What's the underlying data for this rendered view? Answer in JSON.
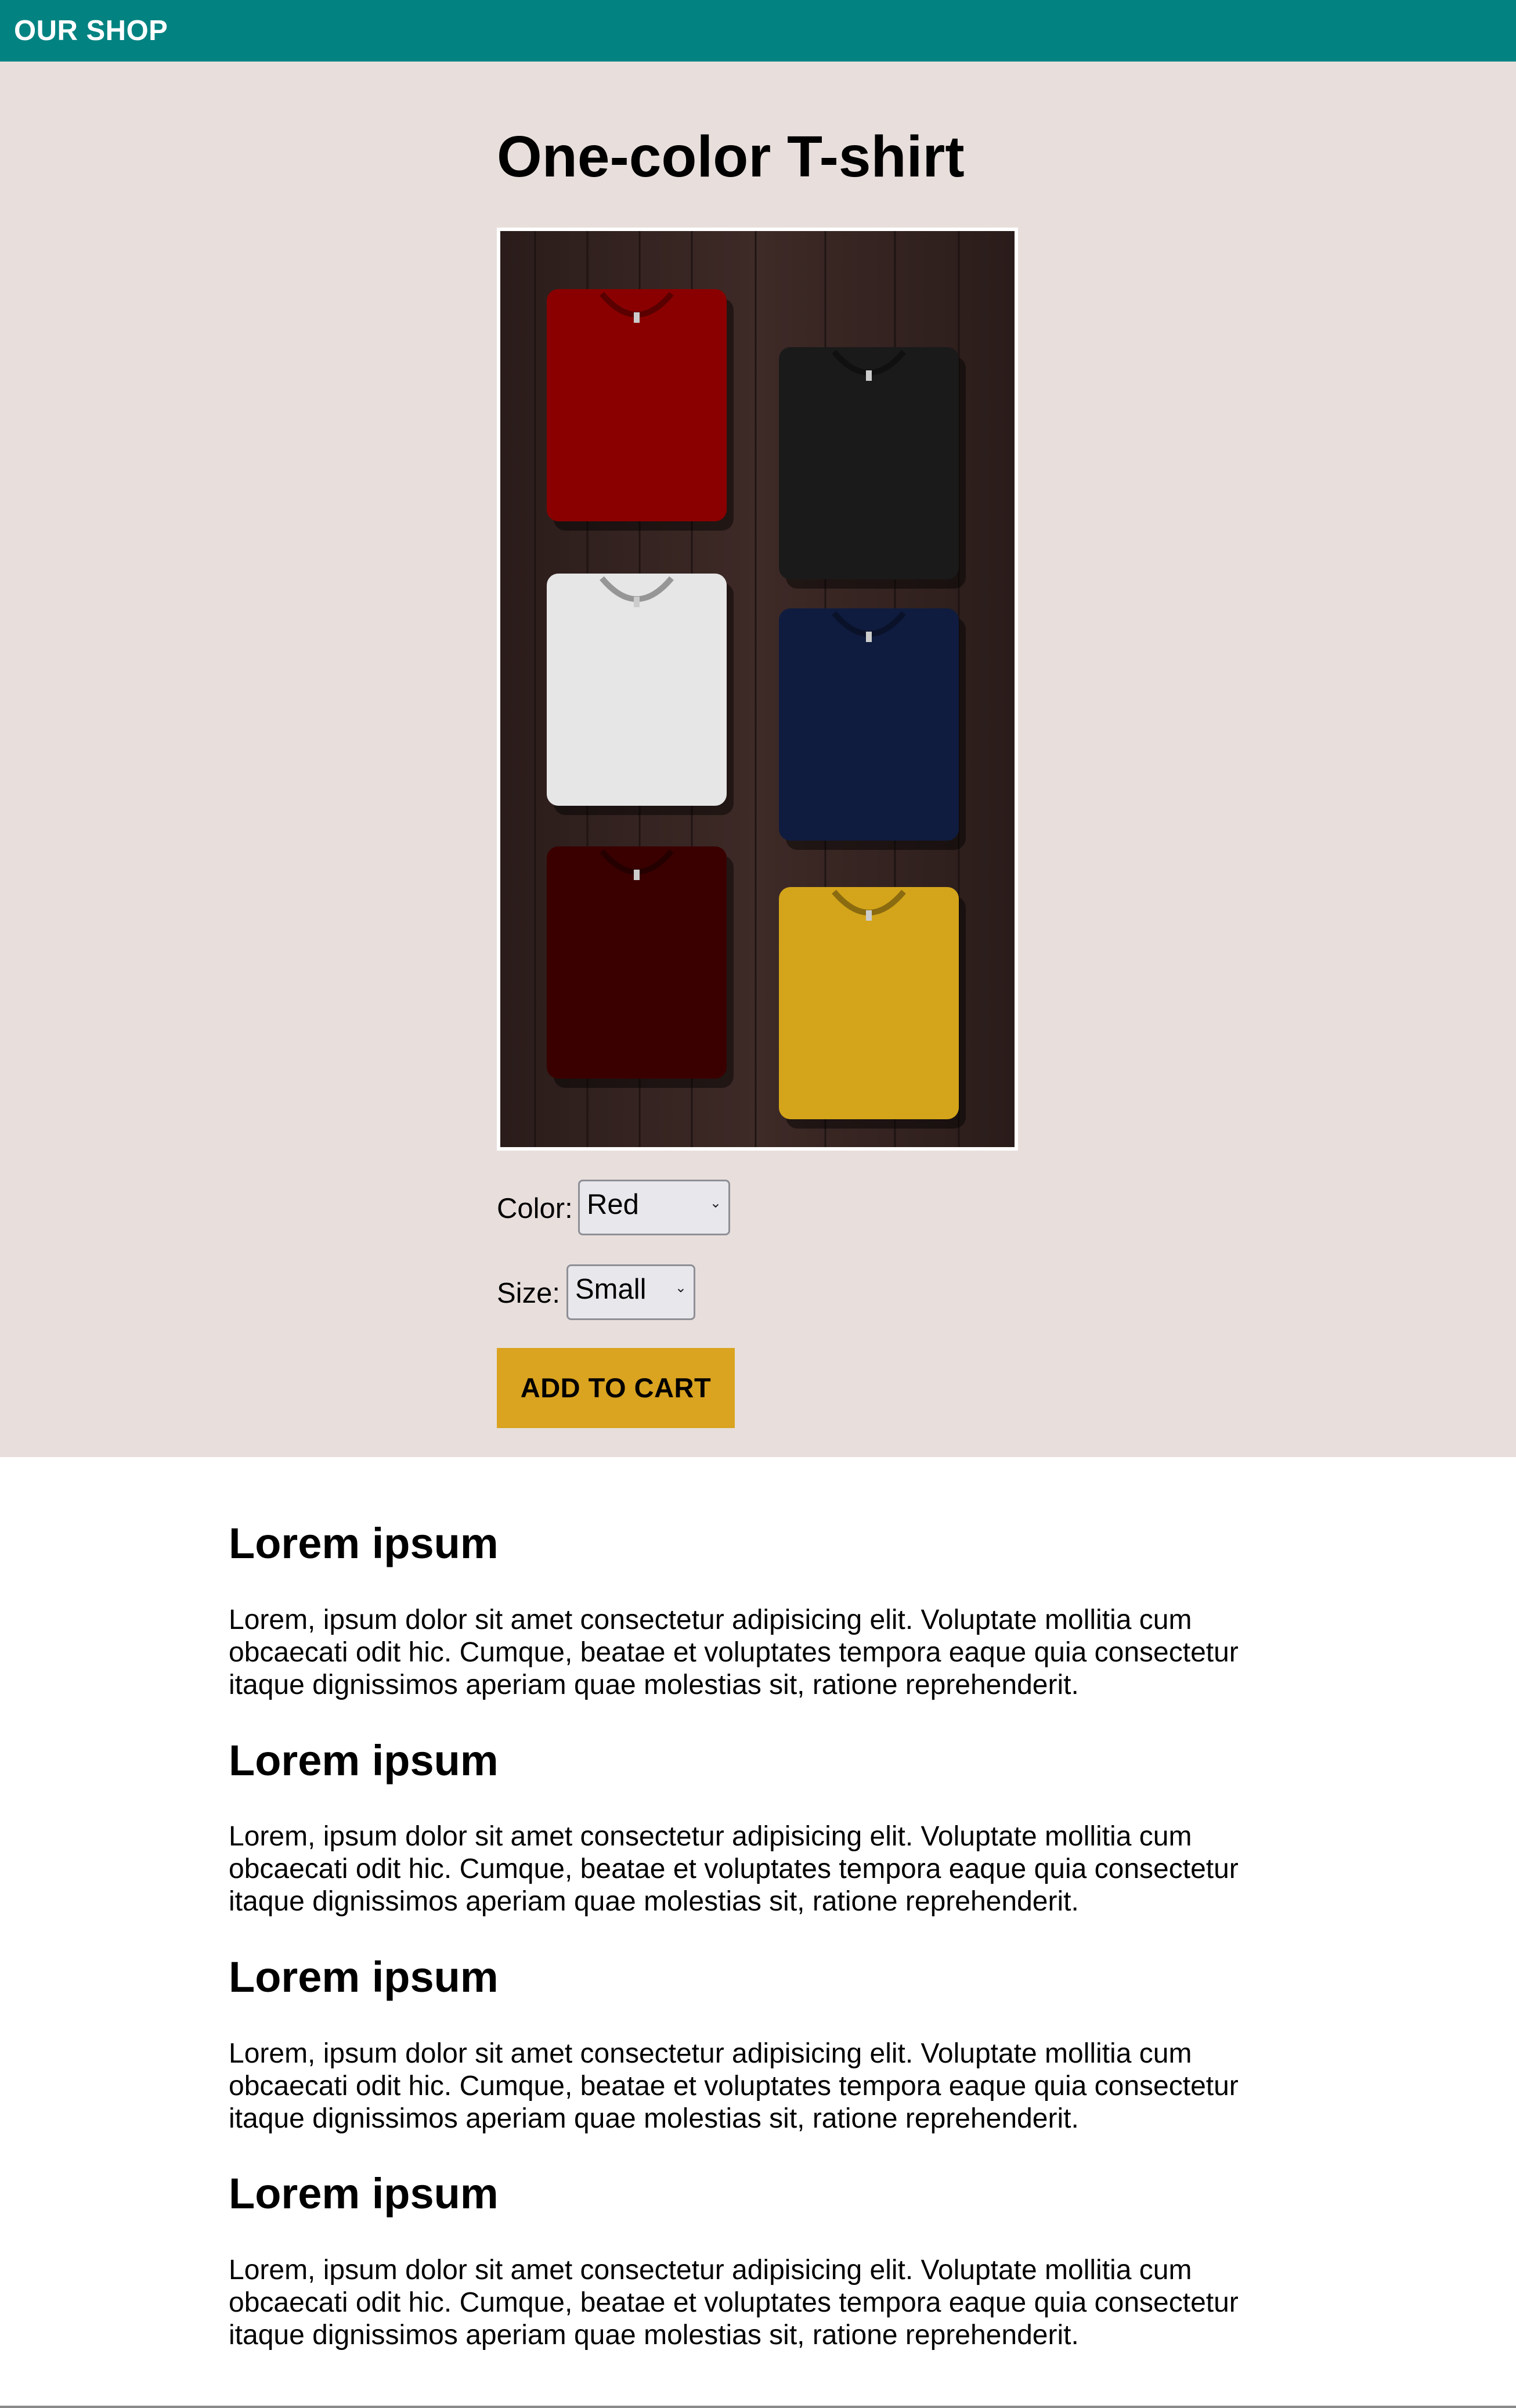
{
  "header": {
    "brand": "OUR SHOP"
  },
  "product": {
    "title": "One-color T-shirt",
    "image_icon": "tshirts-photo",
    "shirt_colors": [
      "#8a0000",
      "#1a1a1a",
      "#e6e6e6",
      "#0f1c3f",
      "#3a0000",
      "#d4a51a"
    ],
    "color_label": "Color:",
    "color_value": "Red",
    "size_label": "Size:",
    "size_value": "Small",
    "add_to_cart": "ADD TO CART"
  },
  "sections": [
    {
      "heading": "Lorem ipsum",
      "body": "Lorem, ipsum dolor sit amet consectetur adipisicing elit. Voluptate mollitia cum obcaecati odit hic. Cumque, beatae et voluptates tempora eaque quia consectetur itaque dignissimos aperiam quae molestias sit, ratione reprehenderit."
    },
    {
      "heading": "Lorem ipsum",
      "body": "Lorem, ipsum dolor sit amet consectetur adipisicing elit. Voluptate mollitia cum obcaecati odit hic. Cumque, beatae et voluptates tempora eaque quia consectetur itaque dignissimos aperiam quae molestias sit, ratione reprehenderit."
    },
    {
      "heading": "Lorem ipsum",
      "body": "Lorem, ipsum dolor sit amet consectetur adipisicing elit. Voluptate mollitia cum obcaecati odit hic. Cumque, beatae et voluptates tempora eaque quia consectetur itaque dignissimos aperiam quae molestias sit, ratione reprehenderit."
    },
    {
      "heading": "Lorem ipsum",
      "body": "Lorem, ipsum dolor sit amet consectetur adipisicing elit. Voluptate mollitia cum obcaecati odit hic. Cumque, beatae et voluptates tempora eaque quia consectetur itaque dignissimos aperiam quae molestias sit, ratione reprehenderit."
    }
  ],
  "colors": {
    "header_bg": "#028381",
    "hero_bg": "#e8dfdc",
    "button_bg": "#daa320"
  }
}
